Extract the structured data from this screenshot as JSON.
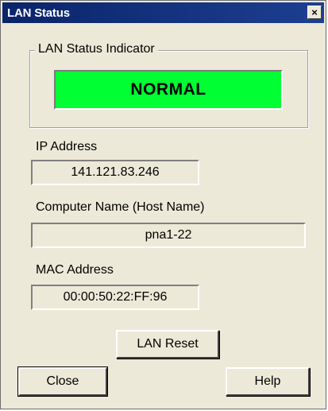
{
  "window": {
    "title": "LAN Status",
    "close_glyph": "×",
    "close_icon": "close-icon"
  },
  "status_group": {
    "legend": "LAN Status Indicator",
    "status": "NORMAL",
    "status_color": "#00ff33"
  },
  "ip": {
    "label": "IP Address",
    "value": "141.121.83.246"
  },
  "host": {
    "label": "Computer Name (Host Name)",
    "value": "pna1-22"
  },
  "mac": {
    "label": "MAC Address",
    "value": "00:00:50:22:FF:96"
  },
  "buttons": {
    "reset": "LAN Reset",
    "close": "Close",
    "help": "Help"
  }
}
